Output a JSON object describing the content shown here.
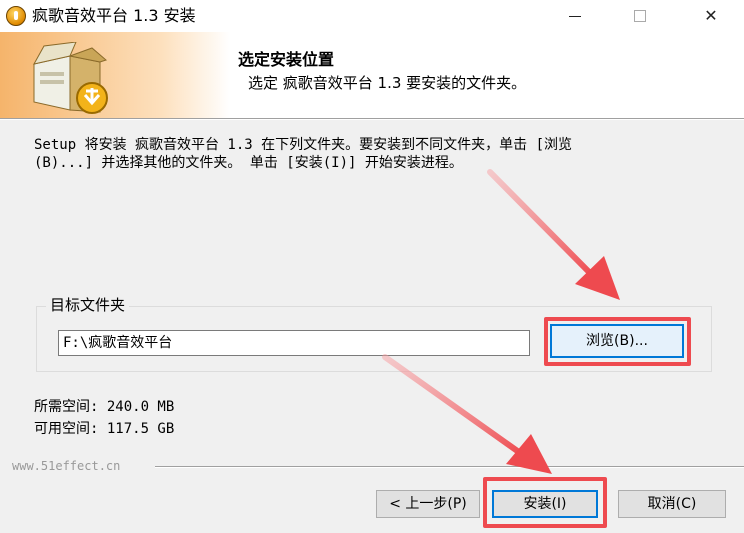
{
  "window": {
    "title": "疯歌音效平台 1.3 安装",
    "minimize": "—",
    "maximize": "☐",
    "close": "✕"
  },
  "header": {
    "title": "选定安装位置",
    "subtitle": "选定 疯歌音效平台 1.3 要安装的文件夹。",
    "icon": "installer-box-icon"
  },
  "body": {
    "description_line1": "Setup 将安装 疯歌音效平台 1.3 在下列文件夹。要安装到不同文件夹，单击 [浏览",
    "description_line2": "(B)...] 并选择其他的文件夹。 单击 [安装(I)] 开始安装进程。"
  },
  "destination": {
    "group_label": "目标文件夹",
    "path_value": "F:\\疯歌音效平台",
    "browse_label": "浏览(B)..."
  },
  "space": {
    "required": "所需空间: 240.0 MB",
    "available": "可用空间: 117.5 GB"
  },
  "brand": "www.51effect.cn",
  "buttons": {
    "back": "< 上一步(P)",
    "install": "安装(I)",
    "cancel": "取消(C)"
  },
  "annotation_color": "#ee4a4f"
}
